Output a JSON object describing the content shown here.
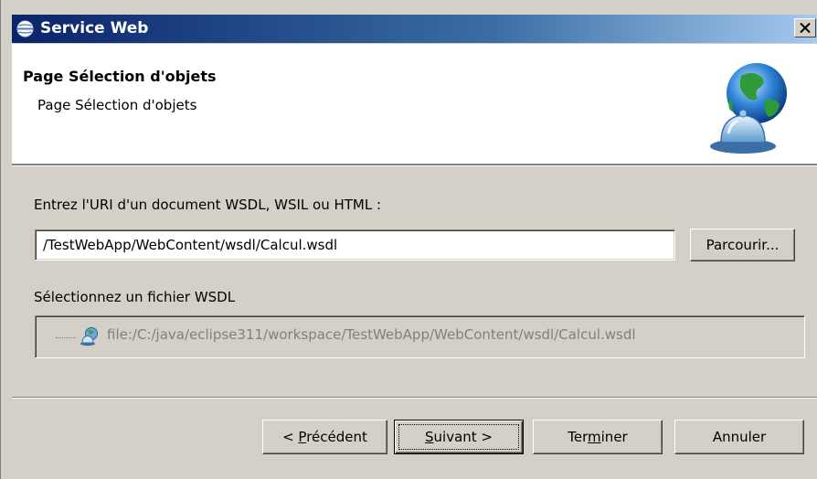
{
  "window": {
    "title": "Service Web",
    "close_glyph": "×"
  },
  "header": {
    "title": "Page Sélection d'objets",
    "description": "Page Sélection d'objets",
    "icon": "globe-bell-icon"
  },
  "form": {
    "uri_label": "Entrez l'URI d'un document WSDL, WSIL ou HTML :",
    "uri_value": "/TestWebApp/WebContent/wsdl/Calcul.wsdl",
    "browse_label": "Parcourir...",
    "wsdl_label": "Sélectionnez un fichier WSDL",
    "wsdl_tree_item": "file:/C:/java/eclipse311/workspace/TestWebApp/WebContent/wsdl/Calcul.wsdl"
  },
  "buttons": {
    "prev": {
      "before": "< ",
      "mnemonic": "P",
      "after": "récédent"
    },
    "next": {
      "before": "",
      "mnemonic": "S",
      "after": "uivant >"
    },
    "finish": {
      "before": "Ter",
      "mnemonic": "m",
      "after": "iner"
    },
    "cancel": "Annuler"
  },
  "colors": {
    "title_bar_start": "#0a246a",
    "title_bar_end": "#a6caf0",
    "dialog_bg": "#d4d0c8",
    "disabled_text": "#808080"
  }
}
